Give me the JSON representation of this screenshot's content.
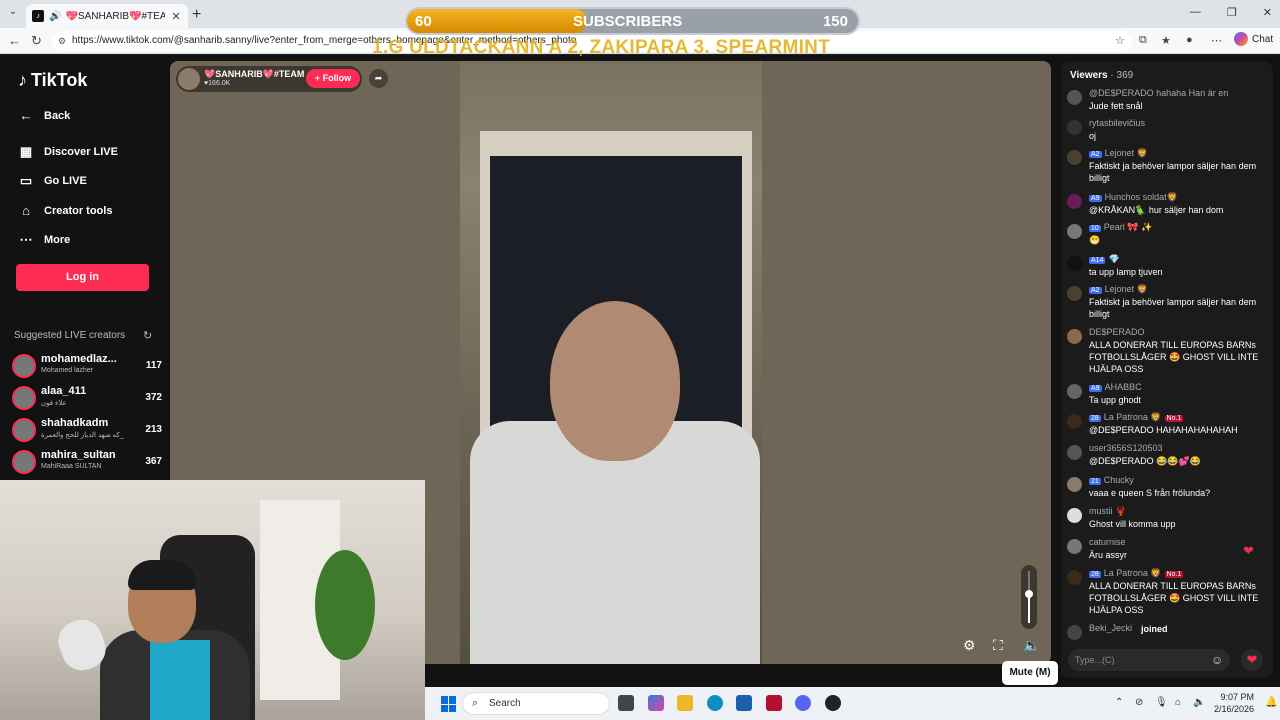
{
  "browser": {
    "tab_title": "💖SANHARIB💖#TEAMSANHARIB",
    "url": "https://www.tiktok.com/@sanharib.sanny/live?enter_from_merge=others_homepage&enter_method=others_photo",
    "chat_button": "Chat"
  },
  "overlay": {
    "sub_current": "60",
    "sub_label": "SUBSCRIBERS",
    "sub_goal": "150",
    "sub_progress": 0.4,
    "ticker": "1.G ULDTACKANN A 2, ZAKIPARA 3. SPEARMINT"
  },
  "sidebar": {
    "logo": "TikTok",
    "back": "Back",
    "items": [
      {
        "label": "Discover LIVE",
        "icon": "calendar-icon"
      },
      {
        "label": "Go LIVE",
        "icon": "camera-icon"
      },
      {
        "label": "Creator tools",
        "icon": "home-icon"
      },
      {
        "label": "More",
        "icon": "more-icon"
      }
    ],
    "login": "Log in",
    "suggested_title": "Suggested LIVE creators",
    "creators": [
      {
        "name": "mohamedlaz...",
        "sub": "Mohamed lazher",
        "count": "117"
      },
      {
        "name": "alaa_411",
        "sub": "علاء فون",
        "count": "372"
      },
      {
        "name": "shahadkadm",
        "sub": "كه شهد الديار للحج والعمرة_",
        "count": "213"
      },
      {
        "name": "mahira_sultan",
        "sub": "MahiRaaa SULTAN",
        "count": "367"
      }
    ]
  },
  "stream": {
    "streamer_name": "💖SANHARIB💖#TEAM...",
    "likes": "♥166.0K",
    "follow": "+ Follow",
    "mute_tooltip": "Mute (M)",
    "volume_level": 0.55
  },
  "chat": {
    "viewers_label": "Viewers",
    "viewers_count": "· 369",
    "messages": [
      {
        "user": "@DE$PERADO hahaha Han är en",
        "text": "Jude fett snål",
        "badge": "",
        "badge2": ""
      },
      {
        "user": "rytasbilevičius",
        "text": "oj",
        "badge": "",
        "badge2": ""
      },
      {
        "user": "Lejonet 🦁",
        "text": "Faktiskt ja behöver lampor säljer han dem billigt",
        "badge": "A2",
        "badge2": ""
      },
      {
        "user": "Hunchos soldat🦁",
        "text": "@KRÅKAN🦜 hur säljer han dom",
        "badge": "A9",
        "badge2": ""
      },
      {
        "user": "Pearl 🎀 ✨",
        "text": "😁",
        "badge": "10",
        "badge2": ""
      },
      {
        "user": "💎",
        "text": "ta upp lamp tjuven",
        "badge": "A14",
        "badge2": ""
      },
      {
        "user": "Lejonet 🦁",
        "text": "Faktiskt ja behöver lampor säljer han dem billigt",
        "badge": "A2",
        "badge2": ""
      },
      {
        "user": "DE$PERADO",
        "text": "ALLA DONERAR TILL EUROPAS BARNs FOTBOLLSLÅGER 🤩 GHOST VILL INTE HJÄLPA OSS",
        "badge": "",
        "badge2": ""
      },
      {
        "user": "AHABBC",
        "text": "Ta upp ghodt",
        "badge": "A9",
        "badge2": ""
      },
      {
        "user": "La Patrona 🦁",
        "text": "@DE$PERADO HAHAHAHAHAHAH",
        "badge": "28",
        "badge2": "No.1"
      },
      {
        "user": "user3656S120503",
        "text": "@DE$PERADO 😂😂💕😂",
        "badge": "",
        "badge2": ""
      },
      {
        "user": "Chucky",
        "text": "vaaa e queen S från frölunda?",
        "badge": "21",
        "badge2": ""
      },
      {
        "user": "mustii 🦞",
        "text": "Ghost vill komma upp",
        "badge": "",
        "badge2": ""
      },
      {
        "user": "caturnise",
        "text": "Äru assyr",
        "badge": "",
        "badge2": ""
      },
      {
        "user": "La Patrona 🦁",
        "text": "ALLA DONERAR TILL EUROPAS BARNs FOTBOLLSLÅGER 🤩 GHOST VILL INTE HJÄLPA OSS",
        "badge": "28",
        "badge2": "No.1"
      },
      {
        "user": "Beki_Jecki",
        "text": "joined",
        "badge": "",
        "badge2": ""
      }
    ],
    "input_placeholder": "Type...(C)"
  },
  "taskbar": {
    "search": "Search",
    "time": "9:07 PM",
    "date": "2/16/2026"
  }
}
